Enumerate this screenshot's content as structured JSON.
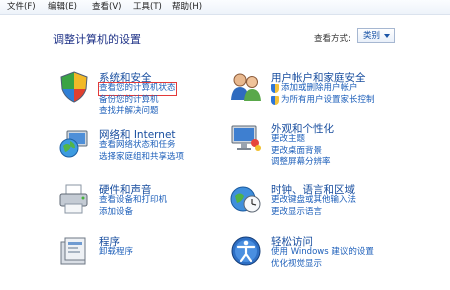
{
  "menu": [
    "文件(F)",
    "编辑(E)",
    "查看(V)",
    "工具(T)",
    "帮助(H)"
  ],
  "page_title": "调整计算机的设置",
  "view_by": {
    "label": "查看方式:",
    "value": "类别"
  },
  "categories": [
    {
      "title": "系统和安全",
      "links": [
        "查看您的计算机状态",
        "备份您的计算机",
        "查找并解决问题"
      ]
    },
    {
      "title": "网络和 Internet",
      "links": [
        "查看网络状态和任务",
        "选择家庭组和共享选项"
      ]
    },
    {
      "title": "硬件和声音",
      "links": [
        "查看设备和打印机",
        "添加设备"
      ]
    },
    {
      "title": "程序",
      "links": [
        "卸载程序"
      ]
    },
    {
      "title": "用户帐户和家庭安全",
      "links": [
        "添加或删除用户帐户",
        "为所有用户设置家长控制"
      ]
    },
    {
      "title": "外观和个性化",
      "links": [
        "更改主题",
        "更改桌面背景",
        "调整屏幕分辨率"
      ]
    },
    {
      "title": "时钟、语言和区域",
      "links": [
        "更改键盘或其他输入法",
        "更改显示语言"
      ]
    },
    {
      "title": "轻松访问",
      "links": [
        "使用 Windows 建议的设置",
        "优化视觉显示"
      ]
    }
  ]
}
